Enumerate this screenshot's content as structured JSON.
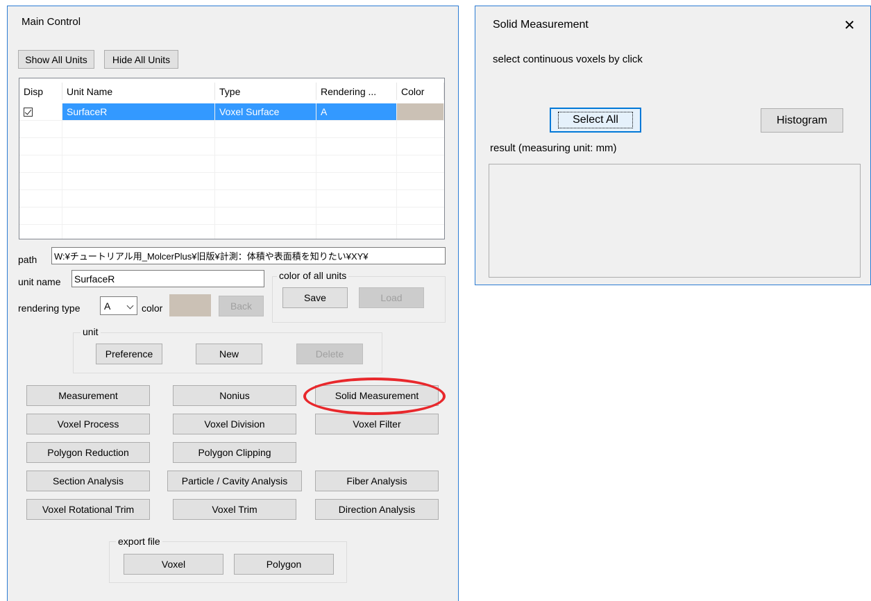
{
  "main": {
    "title": "Main Control",
    "show_all_label": "Show All Units",
    "hide_all_label": "Hide All Units",
    "table": {
      "headers": [
        "Disp",
        "Unit Name",
        "Type",
        "Rendering ...",
        "Color"
      ],
      "rows": [
        {
          "disp": true,
          "unit_name": "SurfaceR",
          "type": "Voxel Surface",
          "rendering": "A",
          "color": "#cbc1b5"
        }
      ]
    },
    "path_label": "path",
    "path_value": "W:¥チュートリアル用_MolcerPlus¥旧版¥計測：体積や表面積を知りたい¥XY¥",
    "unit_name_label": "unit name",
    "unit_name_value": "SurfaceR",
    "color_all_group": "color of all units",
    "save_label": "Save",
    "load_label": "Load",
    "rendering_type_label": "rendering type",
    "rendering_type_value": "A",
    "color_label": "color",
    "color_value": "#cbc1b5",
    "back_label": "Back",
    "unit_group": "unit",
    "preference_label": "Preference",
    "new_label": "New",
    "delete_label": "Delete",
    "tools": {
      "measurement": "Measurement",
      "nonius": "Nonius",
      "solid_measurement": "Solid Measurement",
      "voxel_process": "Voxel Process",
      "voxel_division": "Voxel Division",
      "voxel_filter": "Voxel Filter",
      "polygon_reduction": "Polygon Reduction",
      "polygon_clipping": "Polygon Clipping",
      "section_analysis": "Section Analysis",
      "particle_cavity": "Particle / Cavity Analysis",
      "fiber_analysis": "Fiber Analysis",
      "voxel_rotational_trim": "Voxel Rotational Trim",
      "voxel_trim": "Voxel Trim",
      "direction_analysis": "Direction Analysis"
    },
    "export_group": "export file",
    "voxel_label": "Voxel",
    "polygon_label": "Polygon"
  },
  "solid": {
    "title": "Solid Measurement",
    "instruction": "select continuous voxels by click",
    "select_all_label": "Select All",
    "histogram_label": "Histogram",
    "result_label": "result (measuring unit: mm)",
    "result_text": "",
    "close_glyph": "✕"
  },
  "colors": {
    "accent": "#2b7bd3",
    "selection": "#3399ff",
    "highlight": "#e8282c"
  }
}
